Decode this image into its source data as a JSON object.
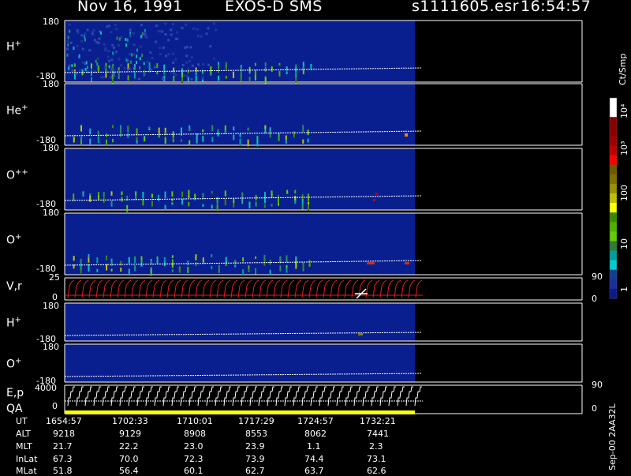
{
  "header": {
    "date": "Nov 16, 1991",
    "instrument": "EXOS-D SMS",
    "file": "s1111605.esr",
    "time": "16:54:57"
  },
  "panels": [
    {
      "id": "h-plus",
      "label": "H",
      "sup": "+",
      "ymax": "180",
      "ymin": "-180",
      "intensity": 1.0
    },
    {
      "id": "he-plus",
      "label": "He",
      "sup": "+",
      "ymax": "180",
      "ymin": "-180",
      "intensity": 0.55
    },
    {
      "id": "o-plus-plus",
      "label": "O",
      "sup": "++",
      "ymax": "180",
      "ymin": "-180",
      "intensity": 0.6
    },
    {
      "id": "o-plus",
      "label": "O",
      "sup": "+",
      "ymax": "180",
      "ymin": "-180",
      "intensity": 0.75
    }
  ],
  "vr_panel": {
    "label": "V,r",
    "ymax": "25",
    "ymin": "0",
    "right_top": "90",
    "right_bottom": "0"
  },
  "lower_panels": [
    {
      "id": "h-plus-lower",
      "label": "H",
      "sup": "+",
      "ymax": "180",
      "ymin": "-180"
    },
    {
      "id": "o-plus-lower",
      "label": "O",
      "sup": "+",
      "ymax": "180",
      "ymin": "-180"
    }
  ],
  "ep_panel": {
    "label1": "E,p",
    "label2": "QA",
    "ymax": "4000",
    "ymin": "0",
    "right_top": "90",
    "right_bottom": "0"
  },
  "colorbar": {
    "unit": "Ct/Smp",
    "ticks": [
      "10⁴",
      "10³",
      "100",
      "10",
      "1"
    ],
    "colors": [
      "#ffffff",
      "#ffffff",
      "#8b0000",
      "#8b0000",
      "#a00000",
      "#c00000",
      "#ff0000",
      "#6b5a00",
      "#807000",
      "#9c9000",
      "#c0c000",
      "#ffff00",
      "#3a8a00",
      "#4fb000",
      "#66cc00",
      "#2e7d32",
      "#00a0a0",
      "#00cccc",
      "#104090",
      "#1a2ea0",
      "#0a1a8a"
    ]
  },
  "ephemeris": {
    "row_labels": [
      "UT",
      "ALT",
      "MLT",
      "InLat",
      "MLat"
    ],
    "columns": [
      {
        "UT": "1654:57",
        "ALT": "9218",
        "MLT": "21.7",
        "InLat": "67.3",
        "MLat": "51.8"
      },
      {
        "UT": "1702:33",
        "ALT": "9129",
        "MLT": "22.2",
        "InLat": "70.0",
        "MLat": "56.4"
      },
      {
        "UT": "1710:01",
        "ALT": "8908",
        "MLT": "23.0",
        "InLat": "72.3",
        "MLat": "60.1"
      },
      {
        "UT": "1717:29",
        "ALT": "8553",
        "MLT": "23.9",
        "InLat": "73.9",
        "MLat": "62.7"
      },
      {
        "UT": "1724:57",
        "ALT": "8062",
        "MLT": "1.1",
        "InLat": "74.4",
        "MLat": "63.7"
      },
      {
        "UT": "1732:21",
        "ALT": "7441",
        "MLT": "2.3",
        "InLat": "73.1",
        "MLat": "62.6"
      }
    ]
  },
  "footer_note": "Sep-00  2AA32L",
  "chart_data": {
    "type": "heatmap",
    "title": "Nov 16, 1991   EXOS-D SMS   s1111605.esr   16:54:57",
    "x_ticks": [
      "1654:57",
      "1702:33",
      "1710:01",
      "1717:29",
      "1724:57",
      "1732:21"
    ],
    "panels": [
      "H+",
      "He+",
      "O++",
      "O+",
      "V,r",
      "H+",
      "O+",
      "E,p"
    ],
    "ylim": [
      -180,
      180
    ],
    "colorbar_unit": "Ct/Smp",
    "colorbar_range": [
      1,
      10000
    ],
    "colorbar_scale": "log"
  }
}
